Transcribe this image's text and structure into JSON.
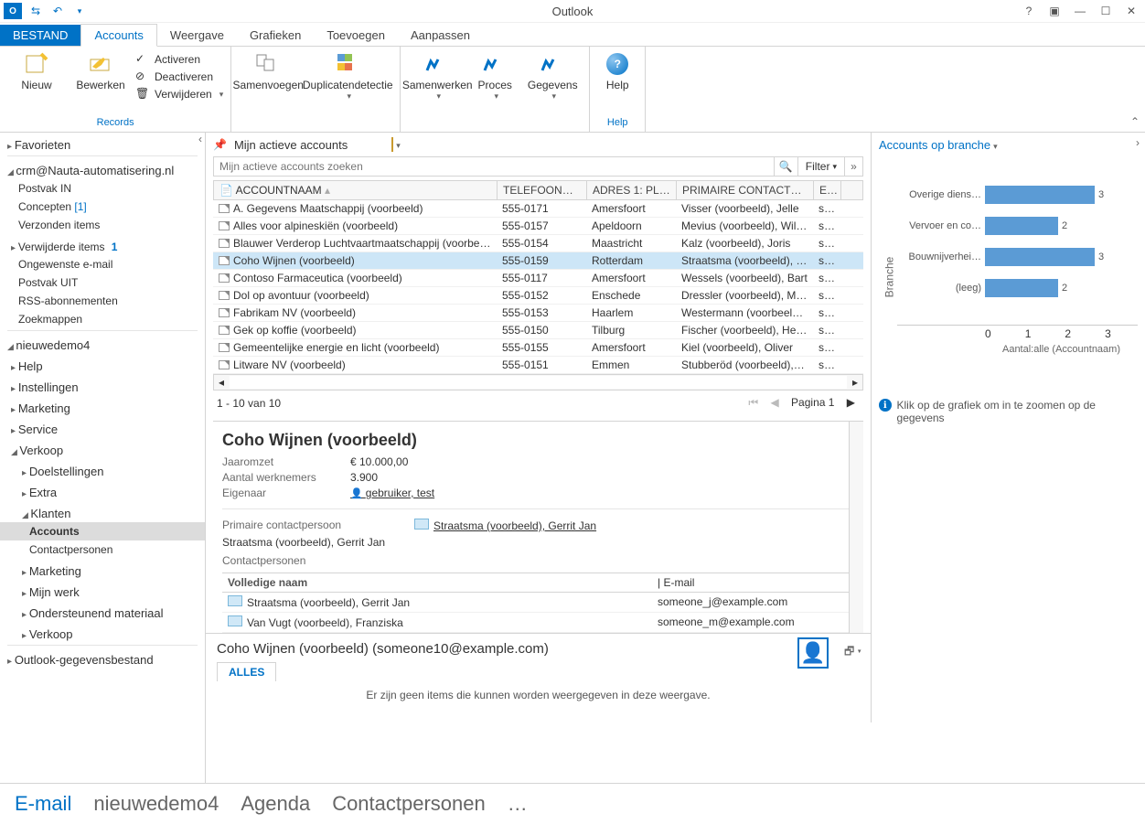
{
  "window": {
    "title": "Outlook"
  },
  "tabs": {
    "file": "BESTAND",
    "accounts": "Accounts",
    "weergave": "Weergave",
    "grafieken": "Grafieken",
    "toevoegen": "Toevoegen",
    "aanpassen": "Aanpassen"
  },
  "ribbon": {
    "g_records": "Records",
    "g_help": "Help",
    "nieuw": "Nieuw",
    "bewerken": "Bewerken",
    "activeren": "Activeren",
    "deactiveren": "Deactiveren",
    "verwijderen": "Verwijderen",
    "samenvoegen": "Samenvoegen",
    "duplicaten": "Duplicatendetectie",
    "samenwerken": "Samenwerken",
    "proces": "Proces",
    "gegevens": "Gegevens",
    "help": "Help"
  },
  "nav": {
    "fav": "Favorieten",
    "acct": "crm@Nauta-automatisering.nl",
    "inbox": "Postvak IN",
    "drafts": "Concepten",
    "drafts_n": "[1]",
    "sent": "Verzonden items",
    "deleted": "Verwijderde items",
    "deleted_n": "1",
    "junk": "Ongewenste e-mail",
    "outbox": "Postvak UIT",
    "rss": "RSS-abonnementen",
    "search": "Zoekmappen",
    "crm": "nieuwedemo4",
    "help": "Help",
    "settings": "Instellingen",
    "marketing": "Marketing",
    "service": "Service",
    "sales": "Verkoop",
    "doel": "Doelstellingen",
    "extra": "Extra",
    "klanten": "Klanten",
    "accounts": "Accounts",
    "contact": "Contactpersonen",
    "marketing2": "Marketing",
    "mywork": "Mijn werk",
    "support": "Ondersteunend materiaal",
    "sales2": "Verkoop",
    "pst": "Outlook-gegevensbestand"
  },
  "main": {
    "view_title": "Mijn actieve accounts",
    "search_ph": "Mijn actieve accounts zoeken",
    "filter": "Filter",
    "h_name": "ACCOUNTNAAM",
    "h_phone": "TELEFOONNUM…",
    "h_city": "ADRES 1: PLAATS",
    "h_contact": "PRIMAIRE CONTACTPERSO…",
    "h_email": "E-N",
    "page_info": "1 - 10 van 10",
    "page_lbl": "Pagina 1",
    "rows": [
      {
        "n": "A. Gegevens Maatschappij (voorbeeld)",
        "p": "555-0171",
        "c": "Amersfoort",
        "ct": "Visser (voorbeeld), Jelle",
        "e": "so…"
      },
      {
        "n": "Alles voor alpineskiën (voorbeeld)",
        "p": "555-0157",
        "c": "Apeldoorn",
        "ct": "Mevius (voorbeeld), Willem",
        "e": "so…"
      },
      {
        "n": "Blauwer Verderop Luchtvaartmaatschappij (voorbeeld)",
        "p": "555-0154",
        "c": "Maastricht",
        "ct": "Kalz (voorbeeld), Joris",
        "e": "so…"
      },
      {
        "n": "Coho Wijnen (voorbeeld)",
        "p": "555-0159",
        "c": "Rotterdam",
        "ct": "Straatsma (voorbeeld), Ger…",
        "e": "so…",
        "sel": true
      },
      {
        "n": "Contoso Farmaceutica (voorbeeld)",
        "p": "555-0117",
        "c": "Amersfoort",
        "ct": "Wessels (voorbeeld), Bart",
        "e": "so…"
      },
      {
        "n": "Dol op avontuur (voorbeeld)",
        "p": "555-0152",
        "c": "Enschede",
        "ct": "Dressler (voorbeeld), Marlies",
        "e": "so…"
      },
      {
        "n": "Fabrikam NV (voorbeeld)",
        "p": "555-0153",
        "c": "Haarlem",
        "ct": "Westermann (voorbeeld), …",
        "e": "so…"
      },
      {
        "n": "Gek op koffie (voorbeeld)",
        "p": "555-0150",
        "c": "Tilburg",
        "ct": "Fischer (voorbeeld), Heinrich",
        "e": "so…"
      },
      {
        "n": "Gemeentelijke energie en licht (voorbeeld)",
        "p": "555-0155",
        "c": "Amersfoort",
        "ct": "Kiel (voorbeeld), Oliver",
        "e": "so…"
      },
      {
        "n": "Litware NV (voorbeeld)",
        "p": "555-0151",
        "c": "Emmen",
        "ct": "Stubberöd (voorbeeld), Su…",
        "e": "so…"
      }
    ]
  },
  "detail": {
    "title": "Coho Wijnen (voorbeeld)",
    "k_rev": "Jaaromzet",
    "v_rev": "€ 10.000,00",
    "k_emp": "Aantal werknemers",
    "v_emp": "3.900",
    "k_own": "Eigenaar",
    "v_own": "gebruiker, test",
    "k_pc": "Primaire contactpersoon",
    "v_pc": "Straatsma (voorbeeld), Gerrit Jan",
    "pc_name": "Straatsma (voorbeeld), Gerrit Jan",
    "ct_title": "Contactpersonen",
    "ct_h1": "Volledige naam",
    "ct_h2": "E-mail",
    "contacts": [
      {
        "n": "Straatsma (voorbeeld), Gerrit Jan",
        "e": "someone_j@example.com"
      },
      {
        "n": "Van Vugt (voorbeeld), Franziska",
        "e": "someone_m@example.com"
      }
    ]
  },
  "reading": {
    "from": "Coho Wijnen (voorbeeld) (someone10@example.com)",
    "tab": "ALLES",
    "empty": "Er zijn geen items die kunnen worden weergegeven in deze weergave."
  },
  "side": {
    "title": "Accounts op branche",
    "ylabel": "Branche",
    "xlabel": "Aantal:alle (Accountnaam)",
    "hint": "Klik op de grafiek om in te zoomen op de gegevens",
    "ticks": [
      "0",
      "1",
      "2",
      "3"
    ]
  },
  "chart_data": {
    "type": "bar",
    "orientation": "horizontal",
    "categories": [
      "Overige diens…",
      "Vervoer en co…",
      "Bouwnijverhei…",
      "(leeg)"
    ],
    "values": [
      3,
      2,
      3,
      2
    ],
    "xlabel": "Aantal:alle (Accountnaam)",
    "ylabel": "Branche",
    "xlim": [
      0,
      3
    ]
  },
  "footer": {
    "email": "E-mail",
    "crm": "nieuwedemo4",
    "agenda": "Agenda",
    "contacts": "Contactpersonen"
  }
}
